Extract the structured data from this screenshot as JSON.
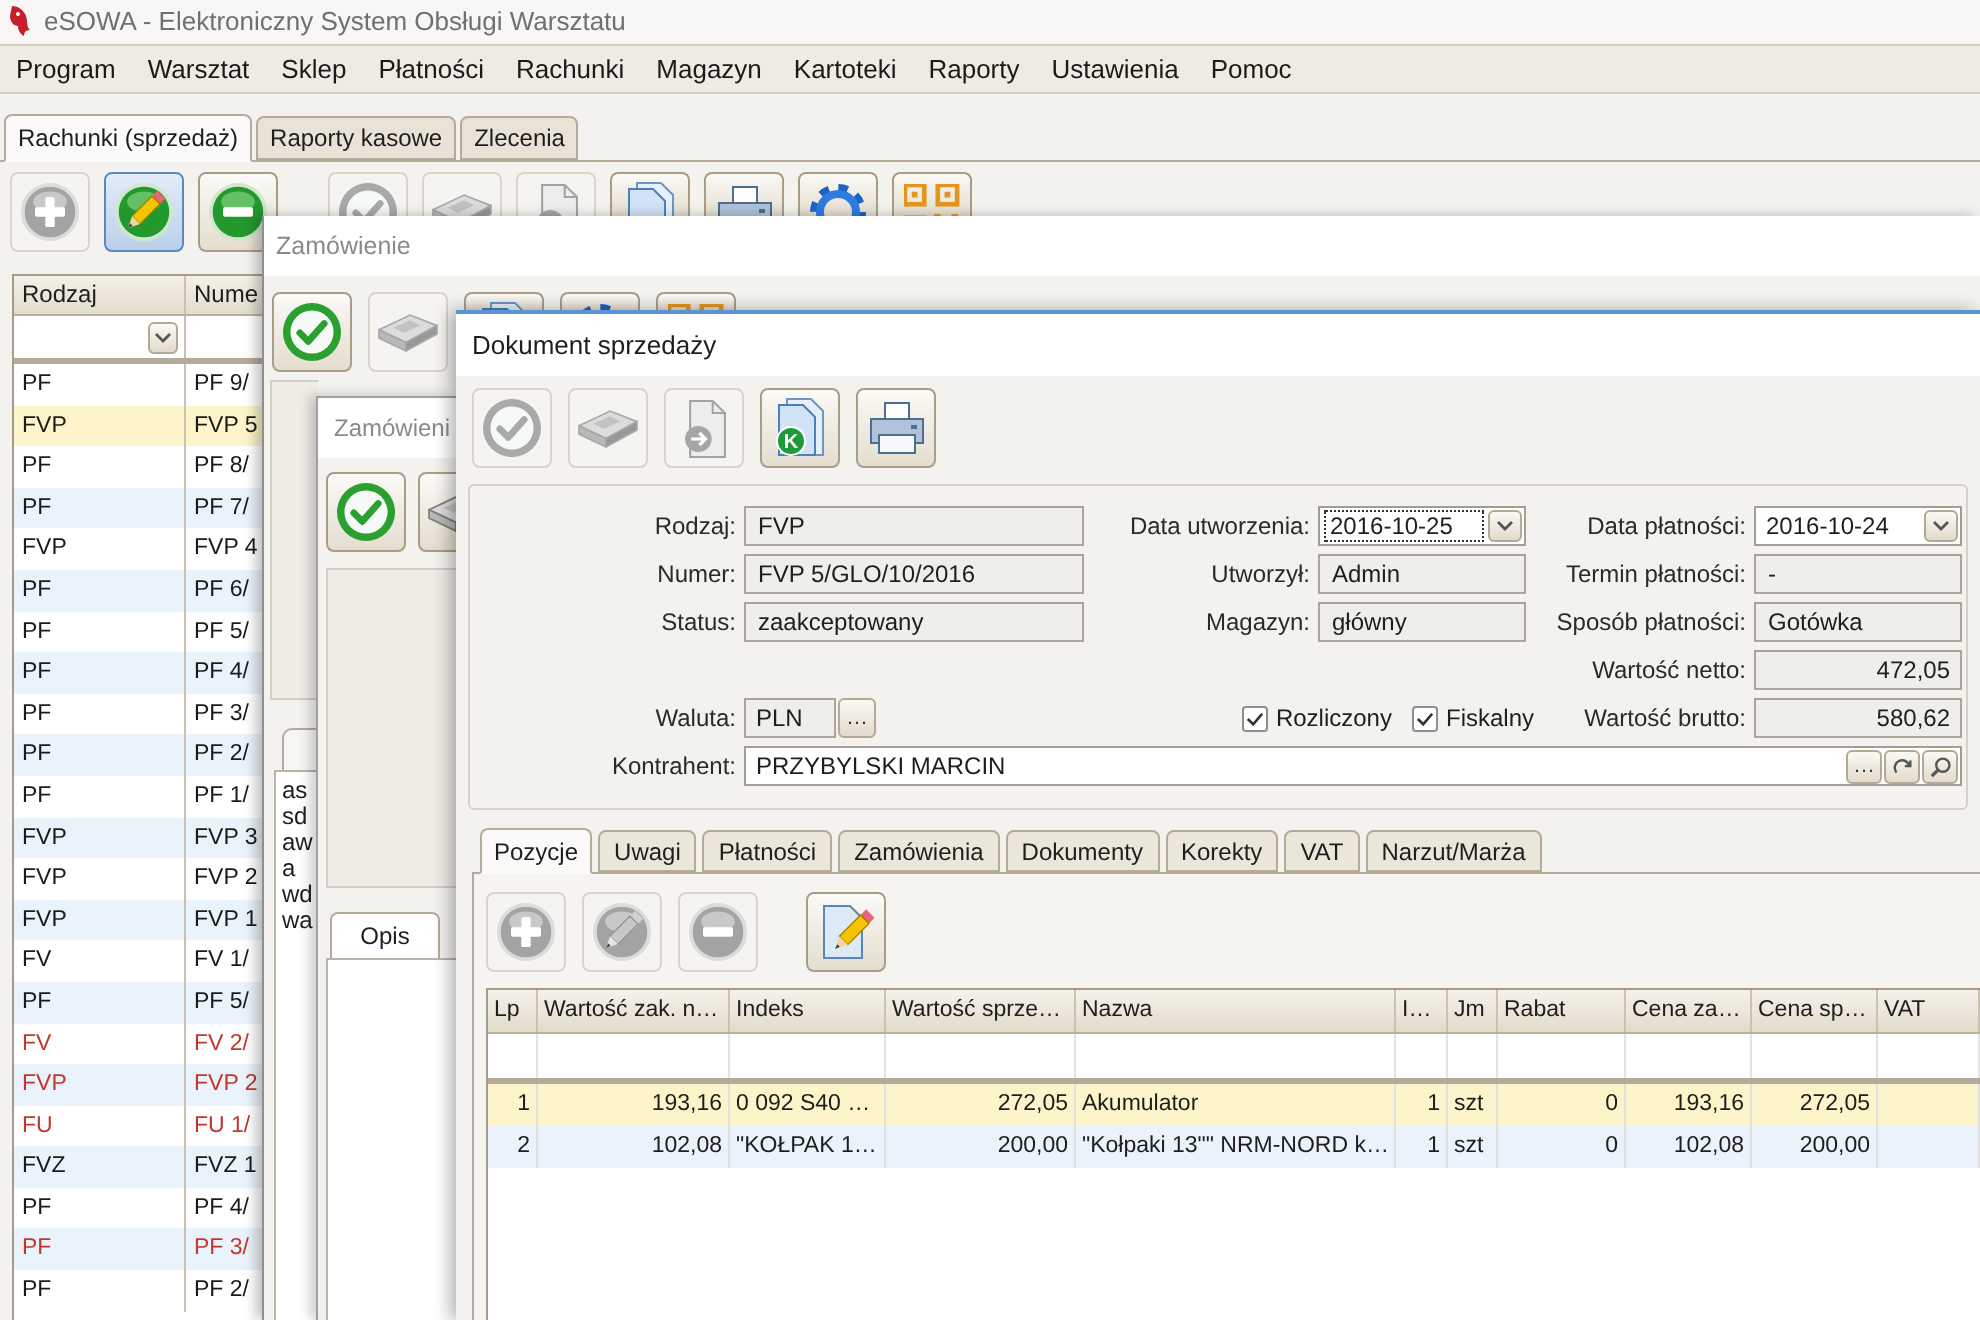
{
  "app": {
    "title": "eSOWA - Elektroniczny System Obsługi Warsztatu"
  },
  "menu": [
    "Program",
    "Warsztat",
    "Sklep",
    "Płatności",
    "Rachunki",
    "Magazyn",
    "Kartoteki",
    "Raporty",
    "Ustawienia",
    "Pomoc"
  ],
  "tabs": [
    {
      "label": "Rachunki (sprzedaż)",
      "selected": true
    },
    {
      "label": "Raporty kasowe",
      "selected": false
    },
    {
      "label": "Zlecenia",
      "selected": false
    }
  ],
  "toolbar": {
    "groups": [
      [
        {
          "kind": "add",
          "disabled": true,
          "pressed": false
        },
        {
          "kind": "edit",
          "disabled": false,
          "pressed": true
        },
        {
          "kind": "delete",
          "disabled": false,
          "pressed": false
        }
      ],
      [
        {
          "kind": "confirm",
          "disabled": true,
          "pressed": false
        },
        {
          "kind": "drawer",
          "disabled": true,
          "pressed": false
        },
        {
          "kind": "transfer",
          "disabled": true,
          "pressed": false
        },
        {
          "kind": "document",
          "disabled": false,
          "pressed": false
        },
        {
          "kind": "print",
          "disabled": false,
          "pressed": false
        },
        {
          "kind": "settings",
          "disabled": false,
          "pressed": false
        },
        {
          "kind": "code",
          "disabled": false,
          "pressed": false
        }
      ]
    ]
  },
  "list": {
    "columns": [
      "Rodzaj",
      "Nume"
    ],
    "rows": [
      {
        "cells": [
          "PF",
          "PF 9/"
        ],
        "selected": false,
        "color": "#1a1a1a"
      },
      {
        "cells": [
          "FVP",
          "FVP 5"
        ],
        "selected": true,
        "color": "#1a1a1a"
      },
      {
        "cells": [
          "PF",
          "PF 8/"
        ],
        "selected": false,
        "color": "#1a1a1a"
      },
      {
        "cells": [
          "PF",
          "PF 7/"
        ],
        "selected": false,
        "color": "#1a1a1a"
      },
      {
        "cells": [
          "FVP",
          "FVP 4"
        ],
        "selected": false,
        "color": "#1a1a1a"
      },
      {
        "cells": [
          "PF",
          "PF 6/"
        ],
        "selected": false,
        "color": "#1a1a1a"
      },
      {
        "cells": [
          "PF",
          "PF 5/"
        ],
        "selected": false,
        "color": "#1a1a1a"
      },
      {
        "cells": [
          "PF",
          "PF 4/"
        ],
        "selected": false,
        "color": "#1a1a1a"
      },
      {
        "cells": [
          "PF",
          "PF 3/"
        ],
        "selected": false,
        "color": "#1a1a1a"
      },
      {
        "cells": [
          "PF",
          "PF 2/"
        ],
        "selected": false,
        "color": "#1a1a1a"
      },
      {
        "cells": [
          "PF",
          "PF 1/"
        ],
        "selected": false,
        "color": "#1a1a1a"
      },
      {
        "cells": [
          "FVP",
          "FVP 3"
        ],
        "selected": false,
        "color": "#1a1a1a"
      },
      {
        "cells": [
          "FVP",
          "FVP 2"
        ],
        "selected": false,
        "color": "#1a1a1a"
      },
      {
        "cells": [
          "FVP",
          "FVP 1"
        ],
        "selected": false,
        "color": "#1a1a1a"
      },
      {
        "cells": [
          "FV",
          "FV 1/"
        ],
        "selected": false,
        "color": "#1a1a1a"
      },
      {
        "cells": [
          "PF",
          "PF 5/"
        ],
        "selected": false,
        "color": "#1a1a1a"
      },
      {
        "cells": [
          "FV",
          "FV 2/"
        ],
        "selected": false,
        "color": "#c0392b"
      },
      {
        "cells": [
          "FVP",
          "FVP 2"
        ],
        "selected": false,
        "color": "#c0392b"
      },
      {
        "cells": [
          "FU",
          "FU 1/"
        ],
        "selected": false,
        "color": "#c0392b"
      },
      {
        "cells": [
          "FVZ",
          "FVZ 1"
        ],
        "selected": false,
        "color": "#1a1a1a"
      },
      {
        "cells": [
          "PF",
          "PF 4/"
        ],
        "selected": false,
        "color": "#1a1a1a"
      },
      {
        "cells": [
          "PF",
          "PF 3/"
        ],
        "selected": false,
        "color": "#c0392b"
      },
      {
        "cells": [
          "PF",
          "PF 2/"
        ],
        "selected": false,
        "color": "#1a1a1a"
      }
    ]
  },
  "order_window": {
    "title": "Zamówienie",
    "toolbar": [
      {
        "kind": "confirm",
        "disabled": false
      },
      {
        "kind": "drawer",
        "disabled": true
      },
      {
        "kind": "document",
        "disabled": false
      },
      {
        "kind": "settings",
        "disabled": false
      },
      {
        "kind": "code",
        "disabled": false
      }
    ],
    "notes": [
      "as",
      "sd",
      "aw",
      "a",
      "wd",
      "wa"
    ]
  },
  "order_window_2": {
    "title": "Zamówieni",
    "toolbar": [
      {
        "kind": "confirm",
        "disabled": false
      },
      {
        "kind": "drawer",
        "disabled": false
      }
    ],
    "tabs": [
      {
        "label": "Opis",
        "selected": true
      }
    ]
  },
  "document": {
    "title": "Dokument sprzedaży",
    "toolbar": [
      {
        "kind": "confirm",
        "disabled": true
      },
      {
        "kind": "drawer",
        "disabled": true
      },
      {
        "kind": "transfer",
        "disabled": true
      },
      {
        "kind": "document",
        "disabled": false,
        "badge": "K"
      },
      {
        "kind": "print",
        "disabled": false
      }
    ],
    "form": {
      "columns": [
        [
          {
            "label": "Rodzaj:",
            "value": "FVP",
            "kind": "text",
            "focused": false
          },
          {
            "label": "Numer:",
            "value": "FVP 5/GLO/10/2016",
            "kind": "text",
            "focused": false
          },
          {
            "label": "Status:",
            "value": "zaakceptowany",
            "kind": "text",
            "focused": false
          }
        ],
        [
          {
            "label": "Data utworzenia:",
            "value": "2016-10-25",
            "kind": "date",
            "focused": true
          },
          {
            "label": "Utworzył:",
            "value": "Admin",
            "kind": "text",
            "focused": false
          },
          {
            "label": "Magazyn:",
            "value": "główny",
            "kind": "text",
            "focused": false
          }
        ],
        [
          {
            "label": "Data płatności:",
            "value": "2016-10-24",
            "kind": "date",
            "focused": false
          },
          {
            "label": "Termin płatności:",
            "value": "-",
            "kind": "text",
            "focused": false
          },
          {
            "label": "Sposób płatności:",
            "value": "Gotówka",
            "kind": "text",
            "focused": false
          },
          {
            "label": "Wartość netto:",
            "value": "472,05",
            "kind": "amount",
            "focused": false
          },
          {
            "label": "Wartość brutto:",
            "value": "580,62",
            "kind": "amount",
            "focused": false
          }
        ]
      ],
      "currency": {
        "label": "Waluta:",
        "value": "PLN",
        "button": "…"
      },
      "checkboxes": [
        {
          "label": "Rozliczony",
          "checked": true
        },
        {
          "label": "Fiskalny",
          "checked": true
        }
      ],
      "contractor": {
        "label": "Kontrahent:",
        "value": "PRZYBYLSKI MARCIN",
        "button": "…"
      }
    },
    "tabs": [
      {
        "label": "Pozycje",
        "selected": true
      },
      {
        "label": "Uwagi",
        "selected": false
      },
      {
        "label": "Płatności",
        "selected": false
      },
      {
        "label": "Zamówienia",
        "selected": false
      },
      {
        "label": "Dokumenty",
        "selected": false
      },
      {
        "label": "Korekty",
        "selected": false
      },
      {
        "label": "VAT",
        "selected": false
      },
      {
        "label": "Narzut/Marża",
        "selected": false
      }
    ],
    "positions_toolbar": {
      "groups": [
        [
          {
            "kind": "add",
            "disabled": true
          },
          {
            "kind": "edit",
            "disabled": true
          },
          {
            "kind": "delete",
            "disabled": true
          }
        ],
        [
          {
            "kind": "edit_document",
            "disabled": false
          }
        ]
      ]
    },
    "grid": {
      "columns": [
        {
          "label": "Lp",
          "kind": "number"
        },
        {
          "label": "Wartość zak. n…",
          "kind": "number"
        },
        {
          "label": "Indeks",
          "kind": "text"
        },
        {
          "label": "Wartość sprze…",
          "kind": "number"
        },
        {
          "label": "Nazwa",
          "kind": "text"
        },
        {
          "label": "I…",
          "kind": "number"
        },
        {
          "label": "Jm",
          "kind": "text"
        },
        {
          "label": "Rabat",
          "kind": "number"
        },
        {
          "label": "Cena za…",
          "kind": "number"
        },
        {
          "label": "Cena sp…",
          "kind": "number"
        },
        {
          "label": "VAT",
          "kind": "text"
        }
      ],
      "rows": [
        {
          "cells": [
            "1",
            "193,16",
            "0 092 S40 …",
            "272,05",
            "Akumulator",
            "1",
            "szt",
            "0",
            "193,16",
            "272,05"
          ],
          "selected": true
        },
        {
          "cells": [
            "2",
            "102,08",
            "\"KOŁPAK 1…",
            "200,00",
            "\"Kołpaki 13\"\" NRM-NORD k…",
            "1",
            "szt",
            "0",
            "102,08",
            "200,00"
          ],
          "selected": false
        }
      ]
    }
  }
}
